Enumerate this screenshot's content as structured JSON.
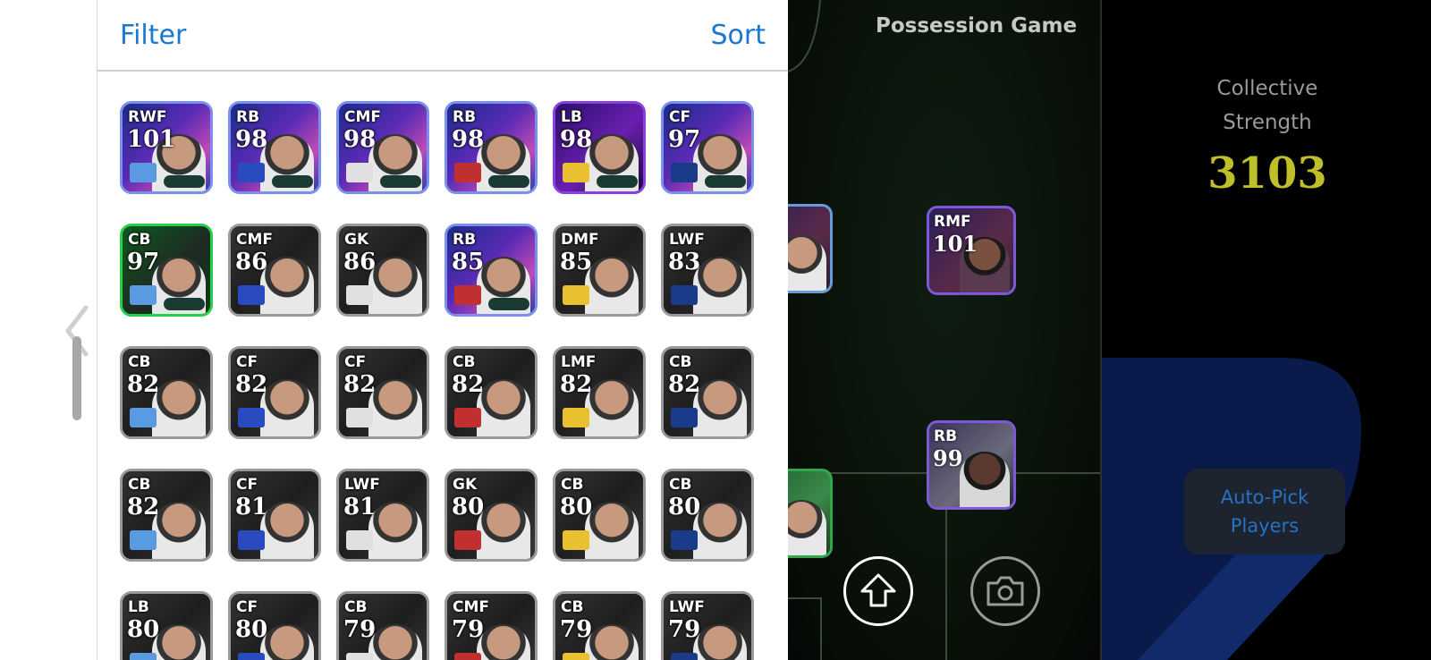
{
  "header": {
    "filter_label": "Filter",
    "sort_label": "Sort"
  },
  "players": [
    {
      "pos": "RWF",
      "ovr": "101",
      "theme": "epic"
    },
    {
      "pos": "RB",
      "ovr": "98",
      "theme": "epic"
    },
    {
      "pos": "CMF",
      "ovr": "98",
      "theme": "epic"
    },
    {
      "pos": "RB",
      "ovr": "98",
      "theme": "epic"
    },
    {
      "pos": "LB",
      "ovr": "98",
      "theme": "purple"
    },
    {
      "pos": "CF",
      "ovr": "97",
      "theme": "epic"
    },
    {
      "pos": "CB",
      "ovr": "97",
      "theme": "green"
    },
    {
      "pos": "CMF",
      "ovr": "86",
      "theme": "gray"
    },
    {
      "pos": "GK",
      "ovr": "86",
      "theme": "gray"
    },
    {
      "pos": "RB",
      "ovr": "85",
      "theme": "epic"
    },
    {
      "pos": "DMF",
      "ovr": "85",
      "theme": "gray"
    },
    {
      "pos": "LWF",
      "ovr": "83",
      "theme": "gray"
    },
    {
      "pos": "CB",
      "ovr": "82",
      "theme": "gray"
    },
    {
      "pos": "CF",
      "ovr": "82",
      "theme": "gray"
    },
    {
      "pos": "CF",
      "ovr": "82",
      "theme": "gray"
    },
    {
      "pos": "CB",
      "ovr": "82",
      "theme": "gray"
    },
    {
      "pos": "LMF",
      "ovr": "82",
      "theme": "gray"
    },
    {
      "pos": "CB",
      "ovr": "82",
      "theme": "gray"
    },
    {
      "pos": "CB",
      "ovr": "82",
      "theme": "gray"
    },
    {
      "pos": "CF",
      "ovr": "81",
      "theme": "gray"
    },
    {
      "pos": "LWF",
      "ovr": "81",
      "theme": "gray"
    },
    {
      "pos": "GK",
      "ovr": "80",
      "theme": "gray"
    },
    {
      "pos": "CB",
      "ovr": "80",
      "theme": "gray"
    },
    {
      "pos": "CB",
      "ovr": "80",
      "theme": "gray"
    },
    {
      "pos": "LB",
      "ovr": "80",
      "theme": "gray"
    },
    {
      "pos": "CF",
      "ovr": "80",
      "theme": "gray"
    },
    {
      "pos": "CB",
      "ovr": "79",
      "theme": "gray"
    },
    {
      "pos": "CMF",
      "ovr": "79",
      "theme": "gray"
    },
    {
      "pos": "CB",
      "ovr": "79",
      "theme": "gray"
    },
    {
      "pos": "LWF",
      "ovr": "79",
      "theme": "gray"
    }
  ],
  "pitch": {
    "title": "Possession Game",
    "players": [
      {
        "pos": "RMF",
        "ovr": "101"
      },
      {
        "pos": "RB",
        "ovr": "99"
      }
    ]
  },
  "side": {
    "strength_label_line1": "Collective",
    "strength_label_line2": "Strength",
    "strength_value": "3103",
    "autopick_line1": "Auto-Pick",
    "autopick_line2": "Players"
  },
  "icons": {
    "upload": "upload-arrow-icon",
    "camera": "camera-icon",
    "back": "chevron-left-icon"
  },
  "colors": {
    "accent": "#1979d2",
    "strength": "#bfbf2a",
    "autopick_text": "#2672c4"
  }
}
